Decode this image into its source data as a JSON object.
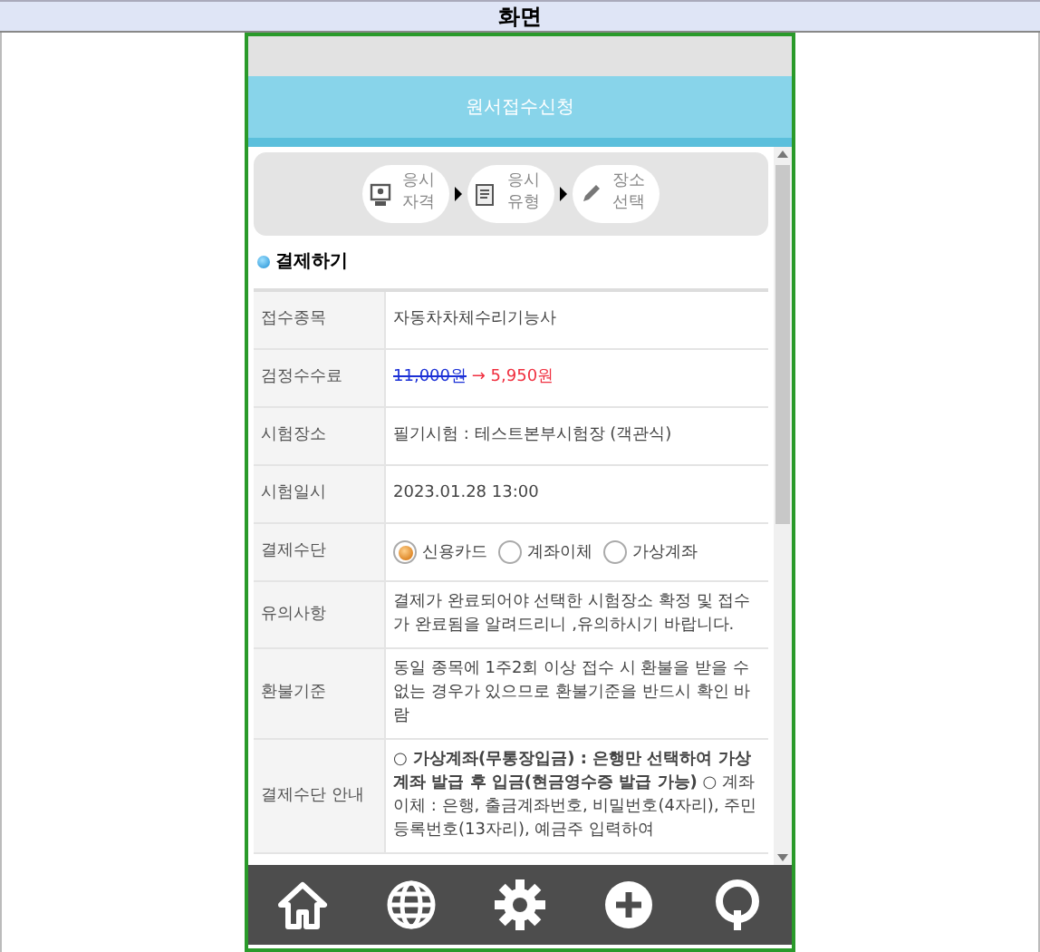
{
  "header": {
    "title": "화면"
  },
  "app": {
    "title": "원서접수신청"
  },
  "steps": [
    {
      "label": "응시\n자격",
      "kind": "person"
    },
    {
      "label": "응시\n유형",
      "kind": "document"
    },
    {
      "label": "장소\n선택",
      "kind": "pencil"
    }
  ],
  "section": {
    "title": "결제하기"
  },
  "rows": [
    {
      "label": "접수종목",
      "kind": "text",
      "value": "자동차차체수리기능사"
    },
    {
      "label": "검정수수료",
      "kind": "fee",
      "old_price": "11,000원",
      "arrow": "→",
      "new_price": "5,950원"
    },
    {
      "label": "시험장소",
      "kind": "text",
      "value": "필기시험 : 테스트본부시험장 (객관식)"
    },
    {
      "label": "시험일시",
      "kind": "text",
      "value": "2023.01.28 13:00"
    },
    {
      "label": "결제수단",
      "kind": "radio",
      "options": [
        {
          "label": "신용카드",
          "selected": true
        },
        {
          "label": "계좌이체",
          "selected": false
        },
        {
          "label": "가상계좌",
          "selected": false
        }
      ]
    },
    {
      "label": "유의사항",
      "kind": "text",
      "value": "결제가 완료되어야 선택한 시험장소 확정 및 접수가 완료됨을 알려드리니 ,유의하시기 바랍니다."
    },
    {
      "label": "환불기준",
      "kind": "text",
      "value": "동일 종목에 1주2회 이상 접수 시 환불을 받을 수 없는 경우가 있으므로 환불기준을 반드시 확인 바람"
    },
    {
      "label": "결제수단 안내",
      "kind": "rich",
      "value": "**○ 가상계좌(무통장입금) : 은행만 선택하여 가상계좌 발급 후 입금(현금영수증 발급 가능)** ○ 계좌이체 : 은행, 출금계좌번호, 비밀번호(4자리), 주민등록번호(13자리), 예금주 입력하여"
    }
  ],
  "nav": [
    {
      "kind": "home"
    },
    {
      "kind": "globe"
    },
    {
      "kind": "gear"
    },
    {
      "kind": "plus"
    },
    {
      "kind": "ring"
    }
  ]
}
